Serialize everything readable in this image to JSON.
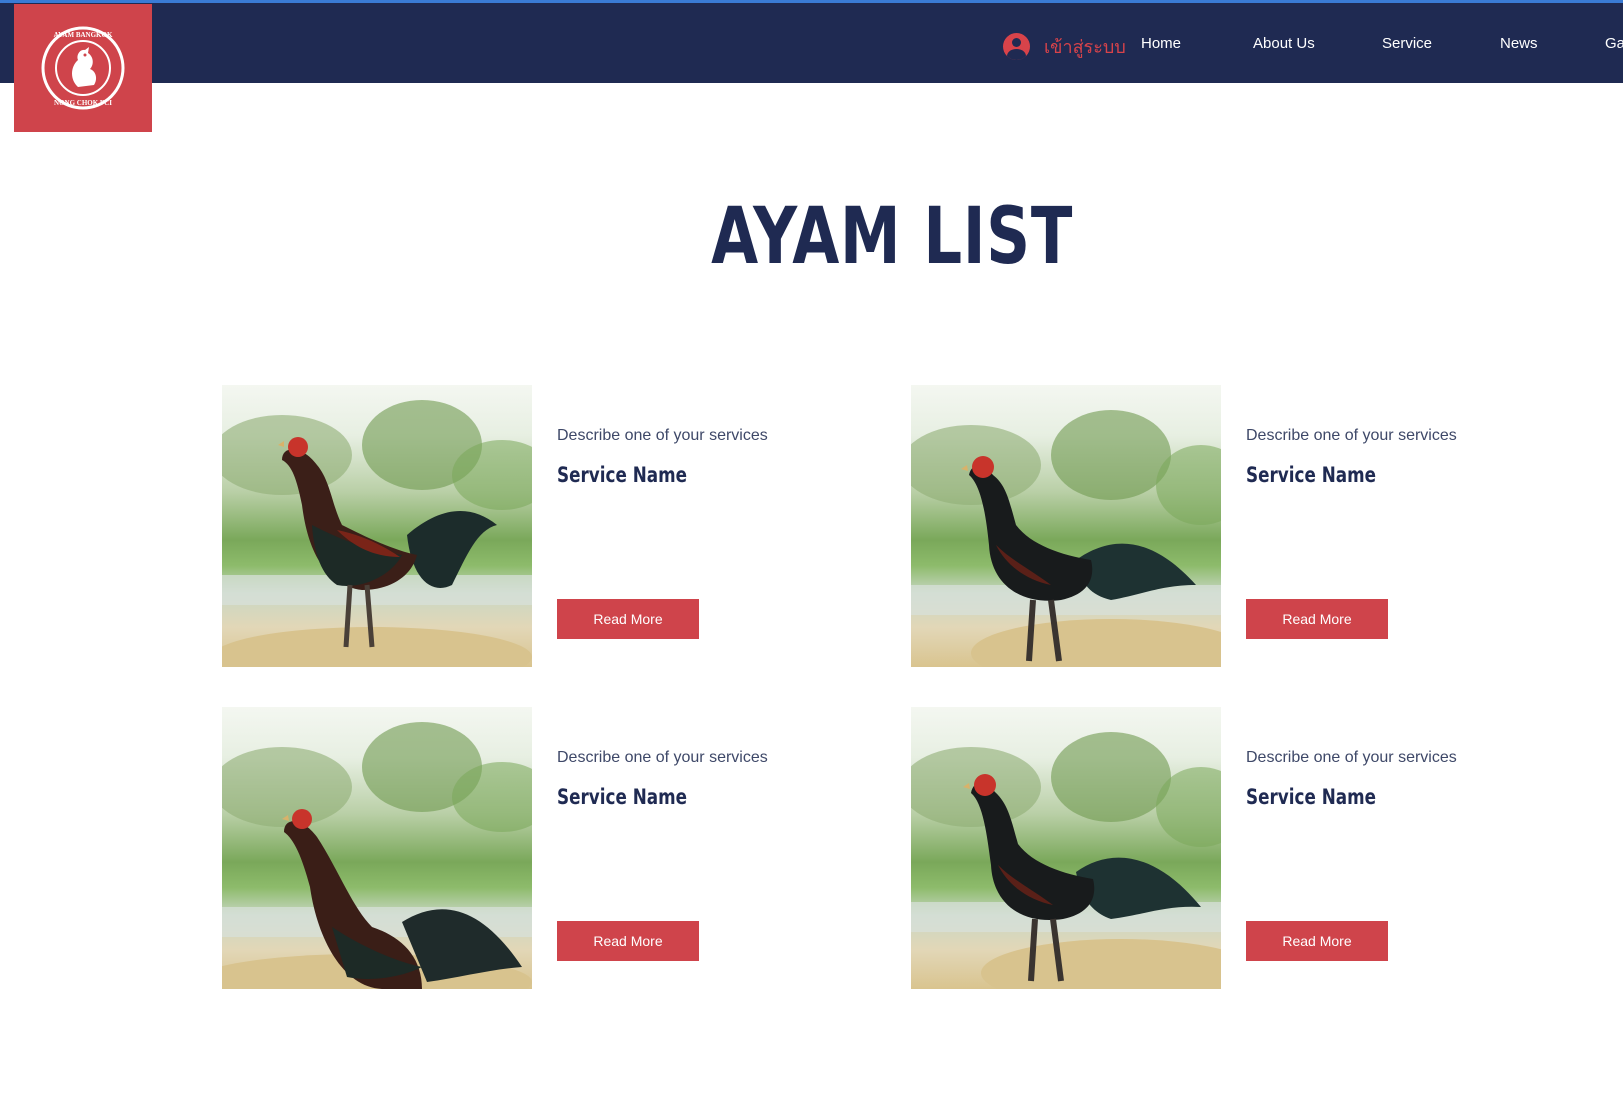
{
  "header": {
    "logo_text_top": "AYAM BANGKOK",
    "logo_text_bottom": "NONG CHOK FCI",
    "login_label": "เข้าสู่ระบบ",
    "login_icon": "user-circle-icon",
    "nav": [
      {
        "label": "Home"
      },
      {
        "label": "About Us"
      },
      {
        "label": "Service"
      },
      {
        "label": "News"
      },
      {
        "label": "Ga"
      }
    ]
  },
  "main": {
    "title": "AYAM LIST",
    "cards": [
      {
        "description": "Describe one of your services",
        "name": "Service Name",
        "button": "Read More"
      },
      {
        "description": "Describe one of your services",
        "name": "Service Name",
        "button": "Read More"
      },
      {
        "description": "Describe one of your services",
        "name": "Service Name",
        "button": "Read More"
      },
      {
        "description": "Describe one of your services",
        "name": "Service Name",
        "button": "Read More"
      }
    ]
  },
  "colors": {
    "navbar": "#1f2a52",
    "accent": "#cf444b",
    "title": "#1f2a52"
  }
}
